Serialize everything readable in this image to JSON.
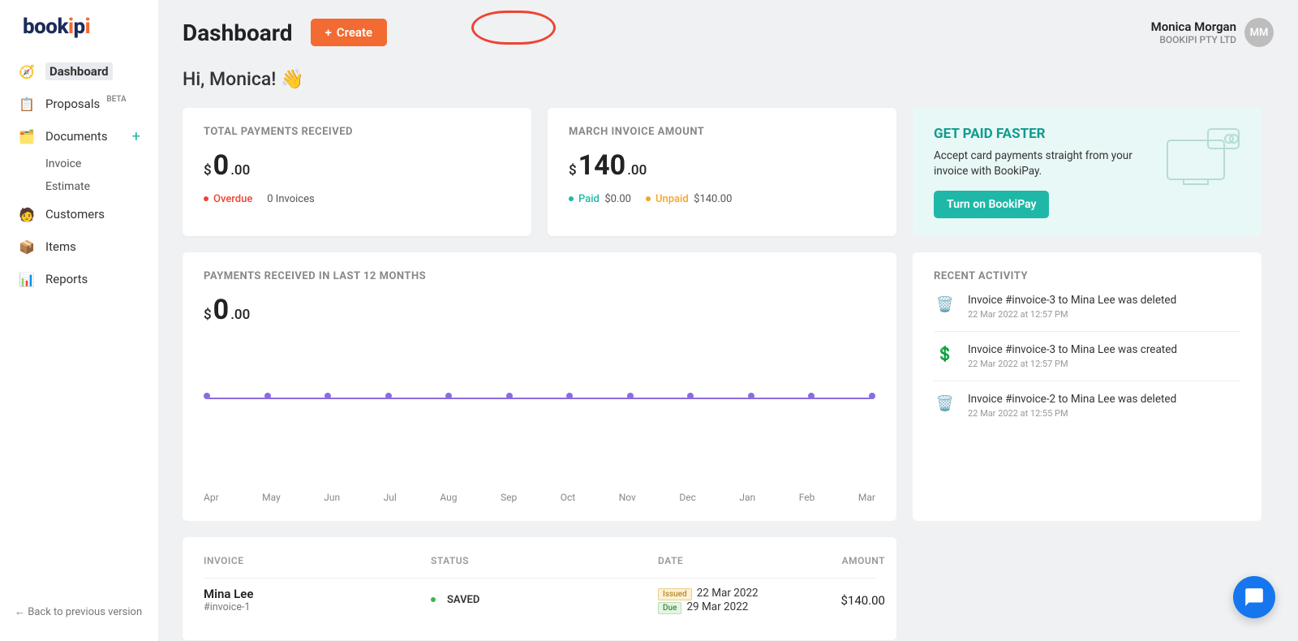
{
  "logo": "bookipi",
  "nav": {
    "dashboard": "Dashboard",
    "proposals": "Proposals",
    "proposals_badge": "BETA",
    "documents": "Documents",
    "invoice": "Invoice",
    "estimate": "Estimate",
    "customers": "Customers",
    "items": "Items",
    "reports": "Reports",
    "footer": "Back to previous version"
  },
  "header": {
    "title": "Dashboard",
    "create": "Create",
    "user_name": "Monica Morgan",
    "company": "BOOKIPI PTY LTD",
    "avatar": "MM"
  },
  "greeting": "Hi, Monica! 👋",
  "total_card": {
    "title": "TOTAL PAYMENTS RECEIVED",
    "currency": "$",
    "whole": "0",
    "dec": ".00",
    "overdue_label": "Overdue",
    "overdue_val": "0 Invoices"
  },
  "month_card": {
    "title": "MARCH INVOICE AMOUNT",
    "currency": "$",
    "whole": "140",
    "dec": ".00",
    "paid_label": "Paid",
    "paid_val": "$0.00",
    "unpaid_label": "Unpaid",
    "unpaid_val": "$140.00"
  },
  "promo": {
    "title": "GET PAID FASTER",
    "text": "Accept card payments straight from your invoice with BookiPay.",
    "cta": "Turn on BookiPay"
  },
  "chart_card": {
    "title": "PAYMENTS RECEIVED IN LAST 12 MONTHS",
    "currency": "$",
    "whole": "0",
    "dec": ".00"
  },
  "chart_data": {
    "type": "line",
    "categories": [
      "Apr",
      "May",
      "Jun",
      "Jul",
      "Aug",
      "Sep",
      "Oct",
      "Nov",
      "Dec",
      "Jan",
      "Feb",
      "Mar"
    ],
    "values": [
      0,
      0,
      0,
      0,
      0,
      0,
      0,
      0,
      0,
      0,
      0,
      0
    ],
    "title": "Payments received in last 12 months",
    "xlabel": "",
    "ylabel": "",
    "ylim": [
      0,
      1
    ]
  },
  "activity": {
    "title": "RECENT ACTIVITY",
    "items": [
      {
        "icon": "trash",
        "text": "Invoice #invoice-3 to Mina Lee was deleted",
        "time": "22 Mar 2022 at 12:57 PM"
      },
      {
        "icon": "doc",
        "text": "Invoice #invoice-3 to Mina Lee was created",
        "time": "22 Mar 2022 at 12:57 PM"
      },
      {
        "icon": "trash",
        "text": "Invoice #invoice-2 to Mina Lee was deleted",
        "time": "22 Mar 2022 at 12:55 PM"
      }
    ]
  },
  "table": {
    "h_invoice": "INVOICE",
    "h_status": "STATUS",
    "h_date": "DATE",
    "h_amount": "AMOUNT",
    "rows": [
      {
        "client": "Mina Lee",
        "num": "#invoice-1",
        "status": "SAVED",
        "issued_tag": "Issued",
        "issued": "22 Mar 2022",
        "due_tag": "Due",
        "due": "29 Mar 2022",
        "amount": "$140.00"
      }
    ]
  }
}
